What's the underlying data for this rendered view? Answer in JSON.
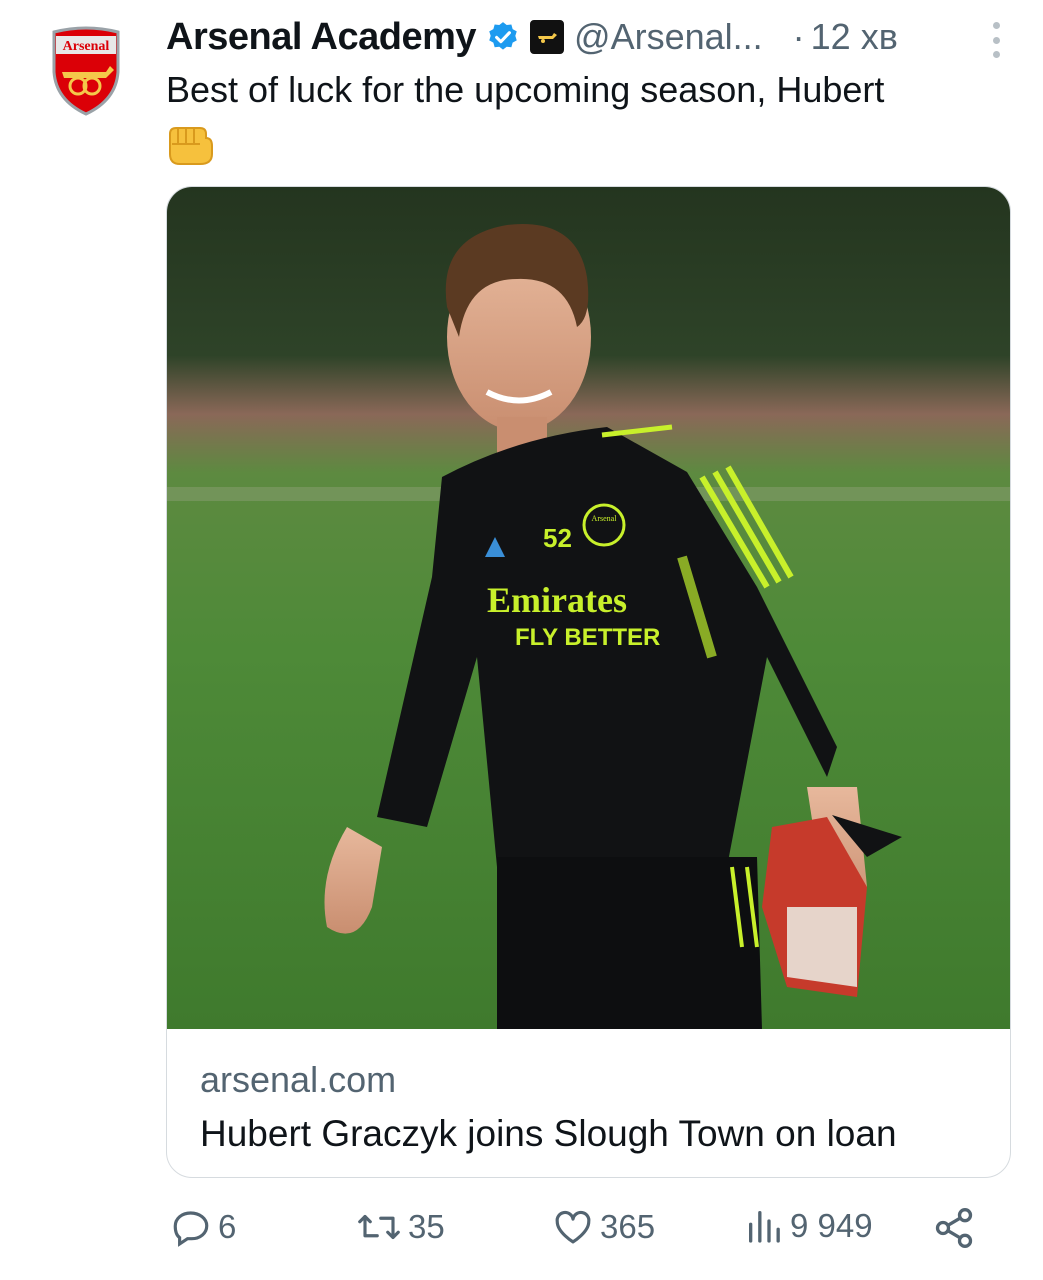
{
  "tweet": {
    "author_name": "Arsenal Academy",
    "handle": "@Arsenal...",
    "separator": "·",
    "time": "12 хв",
    "text": "Best of luck for the upcoming season, Hubert",
    "emoji": "oncoming-fist",
    "avatar_text": "Arsenal",
    "verified_color": "#1d9bf0"
  },
  "link_card": {
    "domain": "arsenal.com",
    "title": "Hubert Graczyk joins Slough Town on loan",
    "shirt_number": "52",
    "sponsor_line1": "Emirates",
    "sponsor_line2": "FLY BETTER",
    "crest_text": "Arsenal"
  },
  "actions": {
    "replies": "6",
    "reposts": "35",
    "likes": "365",
    "views": "9 949"
  },
  "colors": {
    "text": "#0f1419",
    "muted": "#536471",
    "brand_red": "#db0007",
    "kit_accent": "#c8f02b"
  }
}
